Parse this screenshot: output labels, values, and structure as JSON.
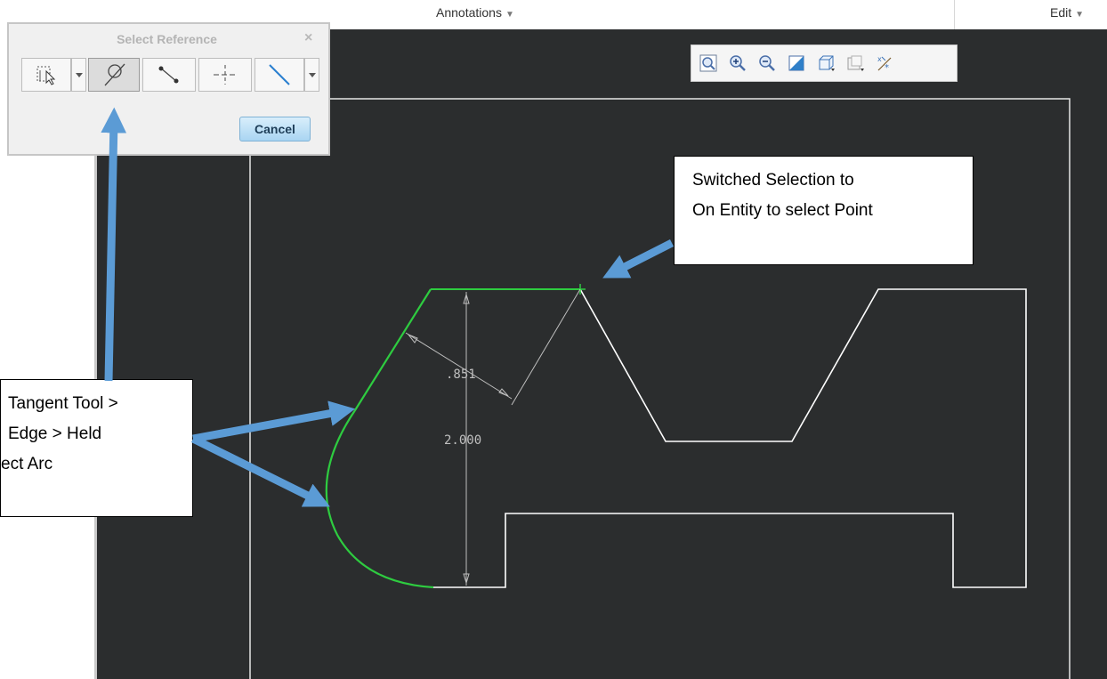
{
  "topbar": {
    "annotations_label": "Annotations",
    "edit_label": "Edit"
  },
  "select_reference": {
    "title": "Select Reference",
    "close_glyph": "×",
    "tools": [
      {
        "icon": "select-entity-icon",
        "has_dropdown": true
      },
      {
        "icon": "tangent-arc-icon",
        "active": true
      },
      {
        "icon": "point-on-entity-icon"
      },
      {
        "icon": "centerline-icon"
      },
      {
        "icon": "line-reference-icon",
        "has_dropdown": true
      }
    ],
    "cancel_label": "Cancel"
  },
  "view_toolbar": {
    "icons": [
      "refit-icon",
      "zoom-in-icon",
      "zoom-out-icon",
      "repaint-icon",
      "display-style-icon",
      "saved-views-icon",
      "sketch-display-icon"
    ]
  },
  "sketch": {
    "dimension_angle_offset": ".851",
    "dimension_height": "2.000",
    "colors": {
      "background": "#2b2d2e",
      "geometry": "#ffffff",
      "selected": "#2ecc40",
      "dimension": "#bfbfbf"
    }
  },
  "callouts": {
    "right_lines": [
      "Switched Selection to",
      "On Entity to select Point"
    ],
    "left_lines": [
      "Tangent Tool >",
      "Edge > Held",
      "ect Arc"
    ]
  },
  "colors": {
    "arrow": "#5b9bd5"
  }
}
